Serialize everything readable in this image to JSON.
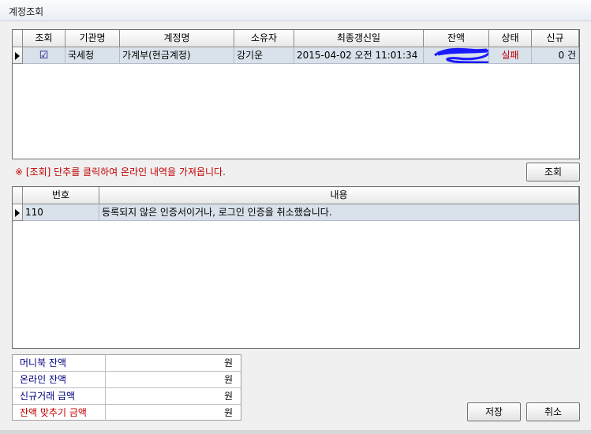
{
  "window": {
    "title": "계정조회"
  },
  "accounts_grid": {
    "headers": [
      "조회",
      "기관명",
      "계정명",
      "소유자",
      "최종갱신일",
      "잔액",
      "상태",
      "신규"
    ],
    "rows": [
      {
        "check": "☑",
        "institution": "국세청",
        "account": "가계부(현금계정)",
        "owner": "강기운",
        "last_updated": "2015-04-02 오전 11:01:34",
        "balance": "",
        "status": "실패",
        "new": "0 건"
      }
    ]
  },
  "notice": "※ [조회] 단추를 클릭하여 온라인 내역을 가져옵니다.",
  "query_button": "조회",
  "messages_grid": {
    "headers": [
      "번호",
      "내용"
    ],
    "rows": [
      {
        "no": "110",
        "content": "등록되지 않은 인증서이거나, 로그인 인증을 취소했습니다."
      }
    ]
  },
  "summary": [
    {
      "label": "머니북 잔액",
      "value": "원",
      "color": "#000080"
    },
    {
      "label": "온라인 잔액",
      "value": "원",
      "color": "#000080"
    },
    {
      "label": "신규거래 금액",
      "value": "원",
      "color": "#000080"
    },
    {
      "label": "잔액 맞추기 금액",
      "value": "원",
      "color": "#c00000"
    }
  ],
  "save_button": "저장",
  "cancel_button": "취소",
  "colors": {
    "status_fail": "#c00000",
    "selected_row": "#d9e2ea",
    "scribble": "#1a1aff"
  }
}
